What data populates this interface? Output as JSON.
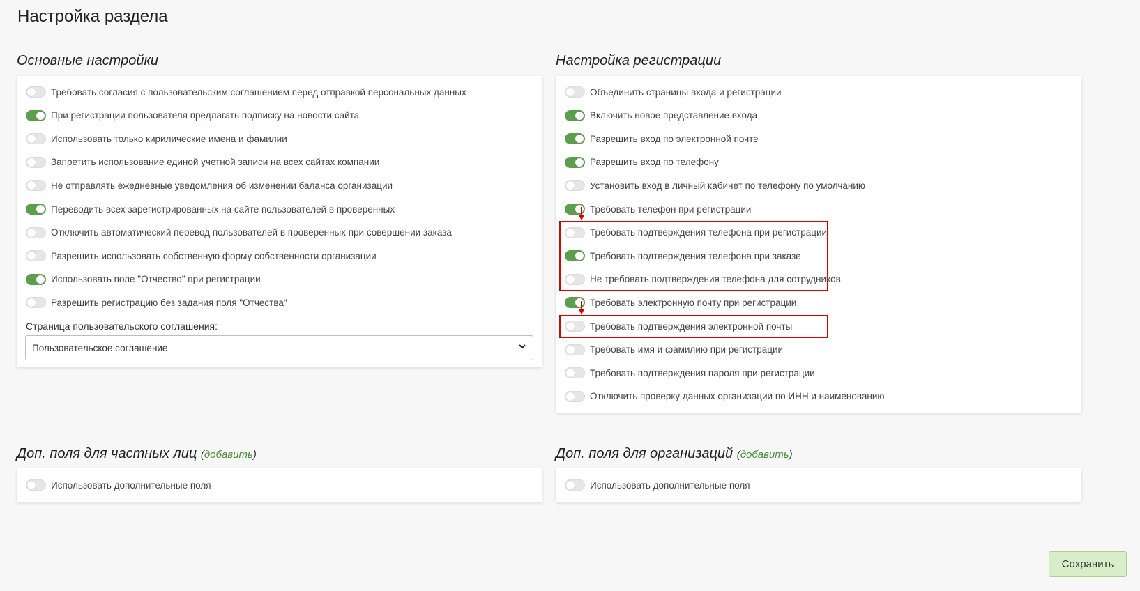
{
  "page_title": "Настройка раздела",
  "main_settings": {
    "title": "Основные настройки",
    "toggles": [
      {
        "label": "Требовать согласия с пользовательским соглашением перед отправкой персональных данных",
        "on": false
      },
      {
        "label": "При регистрации пользователя предлагать подписку на новости сайта",
        "on": true
      },
      {
        "label": "Использовать только кирилические имена и фамилии",
        "on": false
      },
      {
        "label": "Запретить использование единой учетной записи на всех сайтах компании",
        "on": false
      },
      {
        "label": "Не отправлять ежедневные уведомления об изменении баланса организации",
        "on": false
      },
      {
        "label": "Переводить всех зарегистрированных на сайте пользователей в проверенных",
        "on": true
      },
      {
        "label": "Отключить автоматический перевод пользователей в проверенных при совершении заказа",
        "on": false
      },
      {
        "label": "Разрешить использовать собственную форму собственности организации",
        "on": false
      },
      {
        "label": "Использовать поле \"Отчество\" при регистрации",
        "on": true
      },
      {
        "label": "Разрешить регистрацию без задания поля \"Отчества\"",
        "on": false
      }
    ],
    "agreement_label": "Страница пользовательского соглашения:",
    "agreement_value": "Пользовательское соглашение"
  },
  "registration_settings": {
    "title": "Настройка регистрации",
    "toggles": [
      {
        "label": "Объединить страницы входа и регистрации",
        "on": false
      },
      {
        "label": "Включить новое представление входа",
        "on": true
      },
      {
        "label": "Разрешить вход по электронной почте",
        "on": true
      },
      {
        "label": "Разрешить вход по телефону",
        "on": true
      },
      {
        "label": "Установить вход в личный кабинет по телефону по умолчанию",
        "on": false
      },
      {
        "label": "Требовать телефон при регистрации",
        "on": true
      },
      {
        "label": "Требовать подтверждения телефона при регистрации",
        "on": false
      },
      {
        "label": "Требовать подтверждения телефона при заказе",
        "on": true
      },
      {
        "label": "Не требовать подтверждения телефона для сотрудников",
        "on": false
      },
      {
        "label": "Требовать электронную почту при регистрации",
        "on": true
      },
      {
        "label": "Требовать подтверждения электронной почты",
        "on": false
      },
      {
        "label": "Требовать имя и фамилию при регистрации",
        "on": false
      },
      {
        "label": "Требовать подтверждения пароля при регистрации",
        "on": false
      },
      {
        "label": "Отключить проверку данных организации по ИНН и наименованию",
        "on": false
      }
    ]
  },
  "private_fields": {
    "title": "Доп. поля для частных лиц",
    "add_link": "добавить",
    "toggle": {
      "label": "Использовать дополнительные поля",
      "on": false
    }
  },
  "org_fields": {
    "title": "Доп. поля для организаций",
    "add_link": "добавить",
    "toggle": {
      "label": "Использовать дополнительные поля",
      "on": false
    }
  },
  "save_label": "Сохранить",
  "colors": {
    "toggle_on": "#5b9f4c",
    "highlight": "#dd0000",
    "save_bg": "#d9edc9"
  }
}
